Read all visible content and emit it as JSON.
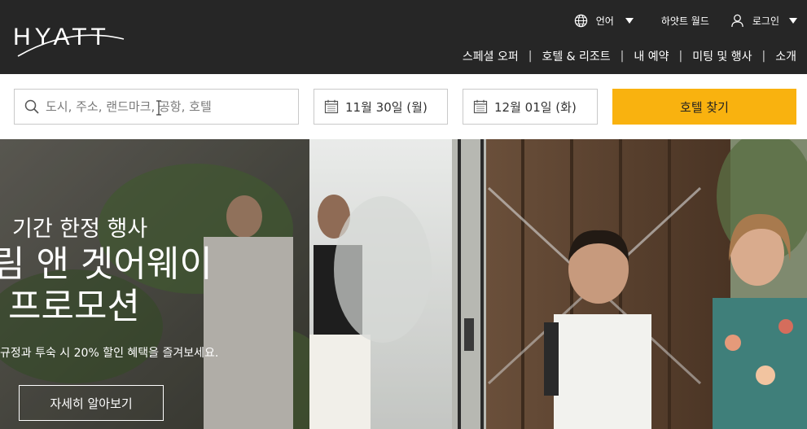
{
  "brand": {
    "logo_text": "HYATT"
  },
  "header": {
    "utility": {
      "language_label": "언어",
      "world_label": "하얏트 월드",
      "login_label": "로그인"
    },
    "nav": [
      {
        "label": "스페셜 오퍼"
      },
      {
        "label": "호텔 & 리조트"
      },
      {
        "label": "내 예약"
      },
      {
        "label": "미팅 및 행사"
      },
      {
        "label": "소개"
      }
    ],
    "nav_separator": "|"
  },
  "search": {
    "destination_placeholder": "도시, 주소, 랜드마크, 공항, 호텔",
    "checkin": "11월 30일 (월)",
    "checkout": "12월 01일 (화)",
    "submit_label": "호텔 찾기"
  },
  "hero": {
    "eyebrow": "기간 한정 행사",
    "title_line1": "림 앤 겟어웨이",
    "title_line2": "프로모션",
    "description": "규정과 투숙 시 20% 할인 혜택을 즐겨보세요.",
    "cta_label": "자세히 알아보기"
  },
  "colors": {
    "header_bg": "#262626",
    "accent_yellow": "#f9b20f",
    "text_white": "#ffffff"
  }
}
